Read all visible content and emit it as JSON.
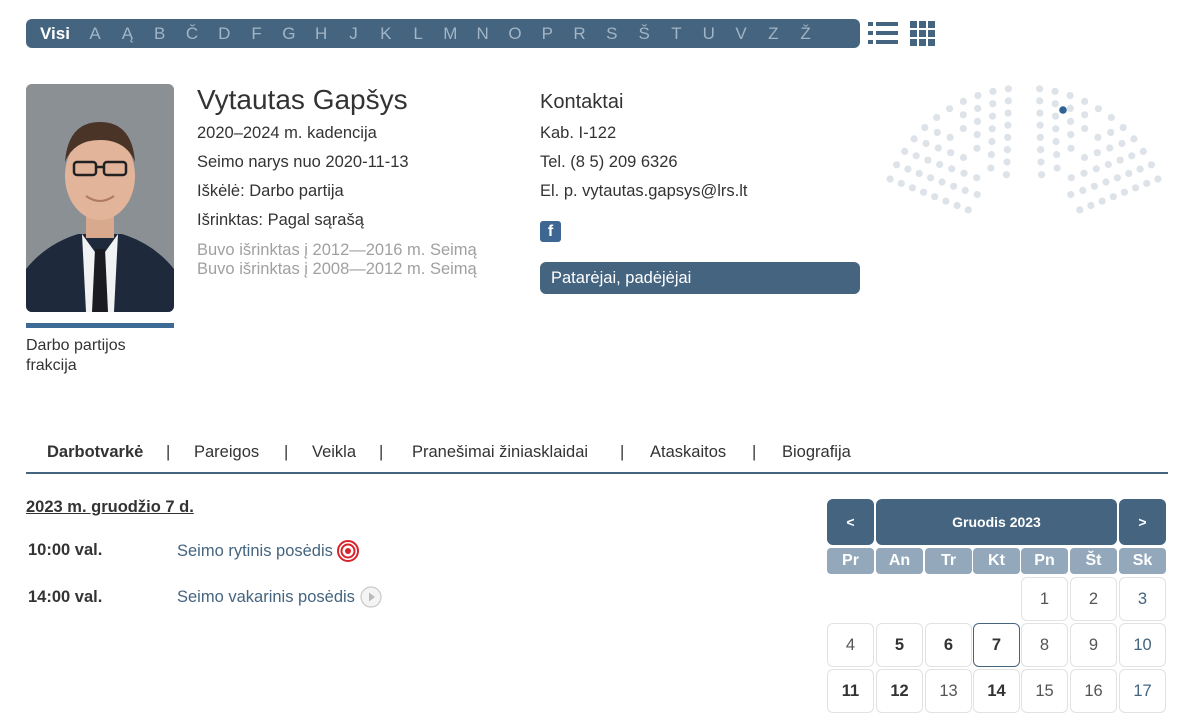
{
  "alphabet": {
    "active": "Visi",
    "letters": [
      "A",
      "Ą",
      "B",
      "Č",
      "D",
      "F",
      "G",
      "H",
      "J",
      "K",
      "L",
      "M",
      "N",
      "O",
      "P",
      "R",
      "S",
      "Š",
      "T",
      "U",
      "V",
      "Z",
      "Ž"
    ]
  },
  "profile": {
    "name": "Vytautas Gapšys",
    "term": "2020–2024 m. kadencija",
    "member_since": "Seimo narys nuo 2020-11-13",
    "nominated": "Iškėlė: Darbo partija",
    "elected": "Išrinktas: Pagal sąrašą",
    "previous_terms": [
      "Buvo išrinktas į 2012—2016 m. Seimą",
      "Buvo išrinktas į 2008—2012 m. Seimą"
    ],
    "fraction": "Darbo partijos frakcija",
    "fraction_color": "#3d6b96"
  },
  "contacts": {
    "title": "Kontaktai",
    "office": "Kab. I-122",
    "phone": "Tel. (8 5) 209 6326",
    "email": "El. p. vytautas.gapsys@lrs.lt",
    "facebook_icon": "f",
    "advisors_button": "Patarėjai, padėjėjai"
  },
  "tabs": [
    "Darbotvarkė",
    "Pareigos",
    "Veikla",
    "Pranešimai žiniasklaidai",
    "Ataskaitos",
    "Biografija"
  ],
  "tab_separator": "|",
  "agenda": {
    "date": "2023 m. gruodžio 7 d.",
    "events": [
      {
        "time": "10:00 val.",
        "title": "Seimo rytinis posėdis",
        "icon": "target-icon"
      },
      {
        "time": "14:00 val.",
        "title": "Seimo vakarinis posėdis",
        "icon": "play-icon"
      }
    ]
  },
  "calendar": {
    "prev": "<",
    "next": ">",
    "month": "Gruodis 2023",
    "weekdays": [
      "Pr",
      "An",
      "Tr",
      "Kt",
      "Pn",
      "Št",
      "Sk"
    ],
    "weeks": [
      [
        "",
        "",
        "",
        "",
        "1",
        "2",
        "3"
      ],
      [
        "4",
        "5",
        "6",
        "7",
        "8",
        "9",
        "10"
      ],
      [
        "11",
        "12",
        "13",
        "14",
        "15",
        "16",
        "17"
      ]
    ]
  },
  "colors": {
    "primary": "#44647f",
    "light_header": "#93a8bb",
    "seat_dot": "#dde3e8",
    "seat_highlight": "#2f6296"
  }
}
